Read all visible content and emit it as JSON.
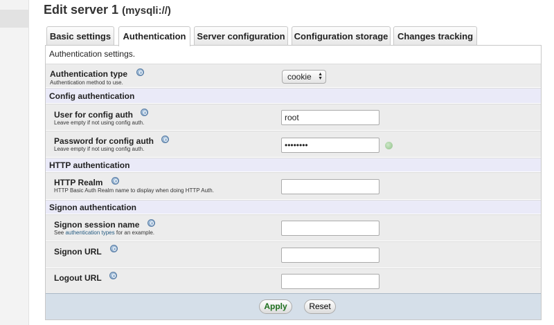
{
  "page": {
    "title": "Edit server 1",
    "subtitle": "(mysqli://)"
  },
  "tabs": [
    {
      "label": "Basic settings"
    },
    {
      "label": "Authentication"
    },
    {
      "label": "Server configuration"
    },
    {
      "label": "Configuration storage"
    },
    {
      "label": "Changes tracking"
    }
  ],
  "active_tab": "Authentication",
  "form": {
    "intro": "Authentication settings.",
    "auth_type": {
      "name": "Authentication type",
      "desc": "Authentication method to use.",
      "value": "cookie"
    },
    "sections": {
      "config_auth": "Config authentication",
      "http_auth": "HTTP authentication",
      "signon_auth": "Signon authentication"
    },
    "user": {
      "name": "User for config auth",
      "desc": "Leave empty if not using config auth.",
      "value": "root"
    },
    "password": {
      "name": "Password for config auth",
      "desc": "Leave empty if not using config auth.",
      "value": "••••••••"
    },
    "http_realm": {
      "name": "HTTP Realm",
      "desc": "HTTP Basic Auth Realm name to display when doing HTTP Auth.",
      "value": ""
    },
    "signon_session": {
      "name": "Signon session name",
      "desc_prefix": "See",
      "desc_link": "authentication types",
      "desc_suffix": "for an example.",
      "value": ""
    },
    "signon_url": {
      "name": "Signon URL",
      "value": ""
    },
    "logout_url": {
      "name": "Logout URL",
      "value": ""
    }
  },
  "buttons": {
    "apply": "Apply",
    "reset": "Reset"
  },
  "icons": {
    "help": "help-icon",
    "restore": "restore-default-icon"
  },
  "colors": {
    "section_background": "#eaeaf8",
    "footer_background": "#d5dfe9",
    "apply_text": "#1d6f1d"
  }
}
